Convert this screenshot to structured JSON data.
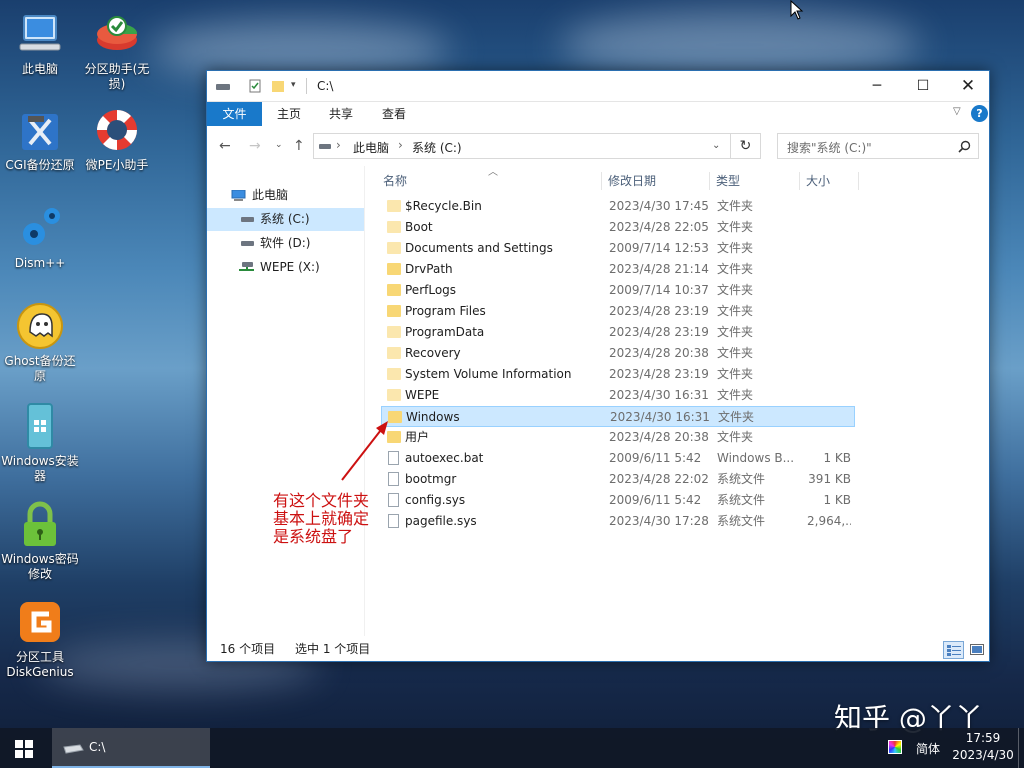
{
  "desktop": {
    "icons": [
      {
        "label": "此电脑",
        "icon": "computer-icon"
      },
      {
        "label": "分区助手(无损)",
        "icon": "partition-assistant-icon"
      },
      {
        "label": "CGI备份还原",
        "icon": "cgi-backup-icon"
      },
      {
        "label": "微PE小助手",
        "icon": "lifebuoy-icon"
      },
      {
        "label": "Dism++",
        "icon": "gears-icon"
      },
      {
        "label": "Ghost备份还原",
        "icon": "ghost-icon"
      },
      {
        "label": "Windows安装器",
        "icon": "windows-installer-icon"
      },
      {
        "label": "Windows密码修改",
        "icon": "padlock-icon"
      },
      {
        "label": "分区工具DiskGenius",
        "icon": "diskgenius-icon"
      }
    ]
  },
  "window": {
    "title": "C:\\",
    "ribbon_tabs": [
      "文件",
      "主页",
      "共享",
      "查看"
    ],
    "breadcrumb": [
      "此电脑",
      "系统 (C:)"
    ],
    "search_placeholder": "搜索\"系统 (C:)\"",
    "nav_items": [
      {
        "label": "此电脑",
        "icon": "computer-icon"
      },
      {
        "label": "系统 (C:)",
        "icon": "drive-icon",
        "selected": true
      },
      {
        "label": "软件 (D:)",
        "icon": "drive-icon"
      },
      {
        "label": "WEPE (X:)",
        "icon": "network-drive-icon"
      }
    ],
    "columns": [
      "名称",
      "修改日期",
      "类型",
      "大小"
    ],
    "files": [
      {
        "name": "$Recycle.Bin",
        "date": "2023/4/30 17:45",
        "type": "文件夹",
        "size": "",
        "kind": "folder-dim"
      },
      {
        "name": "Boot",
        "date": "2023/4/28 22:05",
        "type": "文件夹",
        "size": "",
        "kind": "folder-dim"
      },
      {
        "name": "Documents and Settings",
        "date": "2009/7/14 12:53",
        "type": "文件夹",
        "size": "",
        "kind": "folder-dim"
      },
      {
        "name": "DrvPath",
        "date": "2023/4/28 21:14",
        "type": "文件夹",
        "size": "",
        "kind": "folder"
      },
      {
        "name": "PerfLogs",
        "date": "2009/7/14 10:37",
        "type": "文件夹",
        "size": "",
        "kind": "folder"
      },
      {
        "name": "Program Files",
        "date": "2023/4/28 23:19",
        "type": "文件夹",
        "size": "",
        "kind": "folder"
      },
      {
        "name": "ProgramData",
        "date": "2023/4/28 23:19",
        "type": "文件夹",
        "size": "",
        "kind": "folder-dim"
      },
      {
        "name": "Recovery",
        "date": "2023/4/28 20:38",
        "type": "文件夹",
        "size": "",
        "kind": "folder-dim"
      },
      {
        "name": "System Volume Information",
        "date": "2023/4/28 23:19",
        "type": "文件夹",
        "size": "",
        "kind": "folder-dim"
      },
      {
        "name": "WEPE",
        "date": "2023/4/30 16:31",
        "type": "文件夹",
        "size": "",
        "kind": "folder-dim"
      },
      {
        "name": "Windows",
        "date": "2023/4/30 16:31",
        "type": "文件夹",
        "size": "",
        "kind": "folder",
        "selected": true
      },
      {
        "name": "用户",
        "date": "2023/4/28 20:38",
        "type": "文件夹",
        "size": "",
        "kind": "folder"
      },
      {
        "name": "autoexec.bat",
        "date": "2009/6/11 5:42",
        "type": "Windows B...",
        "size": "1 KB",
        "kind": "file"
      },
      {
        "name": "bootmgr",
        "date": "2023/4/28 22:02",
        "type": "系统文件",
        "size": "391 KB",
        "kind": "file"
      },
      {
        "name": "config.sys",
        "date": "2009/6/11 5:42",
        "type": "系统文件",
        "size": "1 KB",
        "kind": "file"
      },
      {
        "name": "pagefile.sys",
        "date": "2023/4/30 17:28",
        "type": "系统文件",
        "size": "2,964,...",
        "kind": "file"
      }
    ],
    "status": {
      "count": "16 个项目",
      "selected": "选中 1 个项目"
    }
  },
  "annotation": {
    "lines": [
      "有这个文件夹",
      "基本上就确定",
      "是系统盘了"
    ],
    "color": "#cc1111"
  },
  "watermark": "知乎 @丫丫",
  "taskbar": {
    "task_label": "C:\\",
    "ime": "简体",
    "time": "17:59",
    "date": "2023/4/30"
  }
}
